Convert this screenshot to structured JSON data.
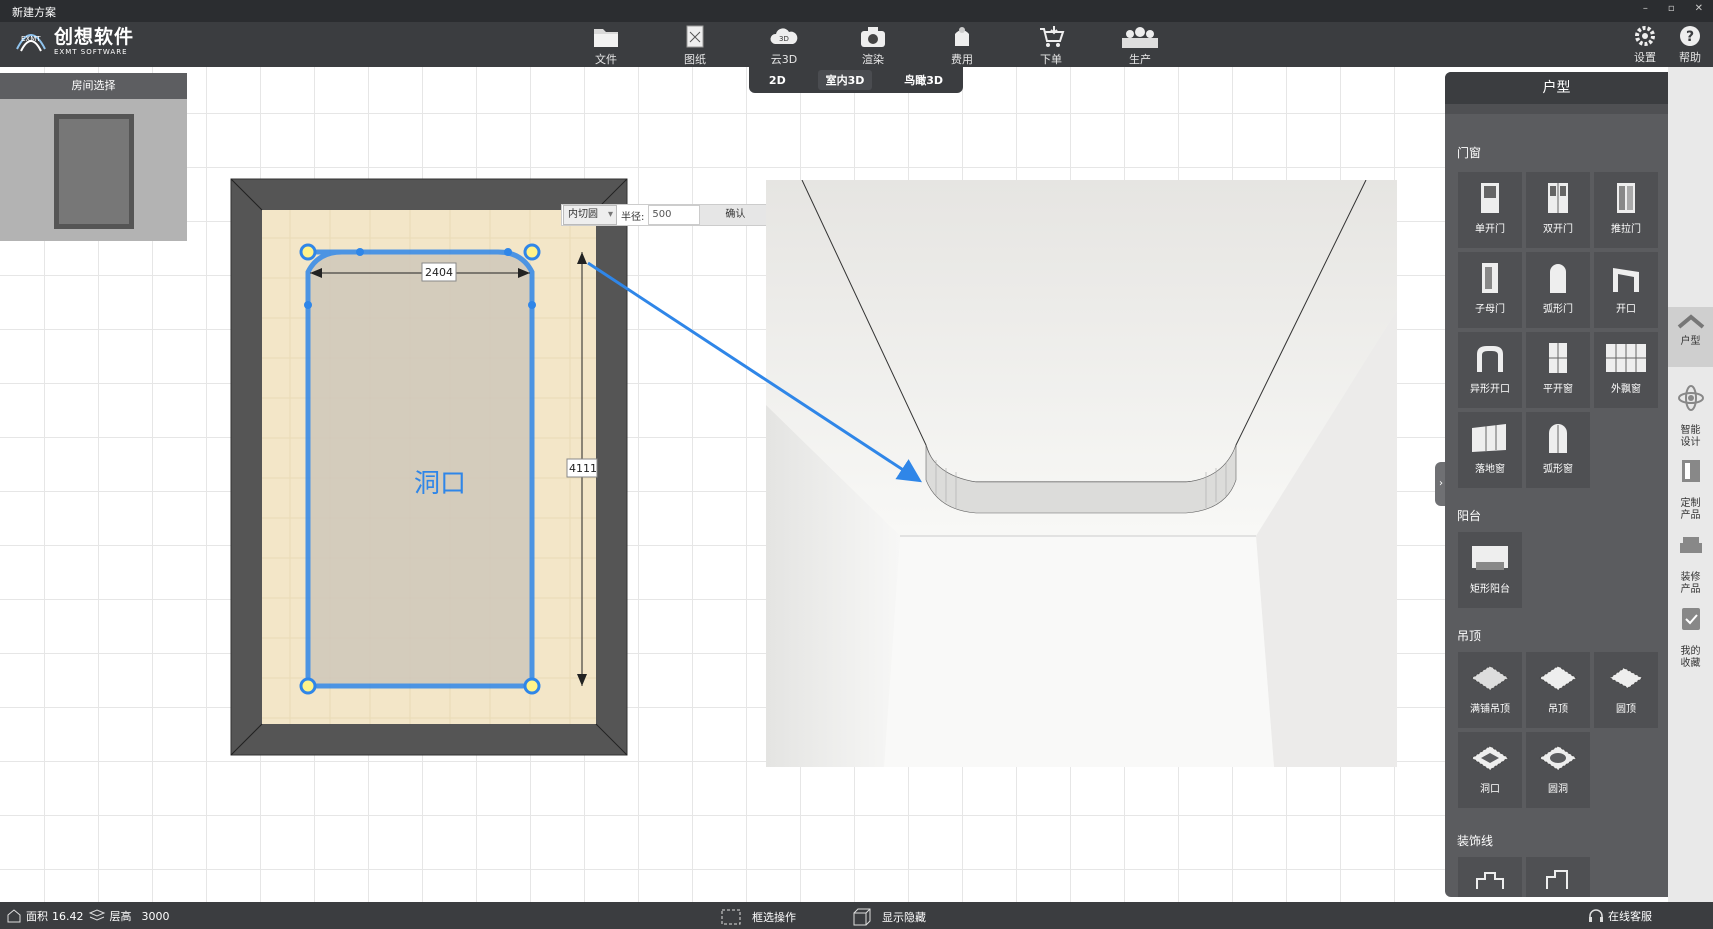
{
  "window": {
    "title": "新建方案",
    "controls": [
      "–",
      "▫",
      "✕"
    ]
  },
  "logo": {
    "name": "创想软件",
    "sub": "EXMT SOFTWARE",
    "mark": "EXMT"
  },
  "toolbar": {
    "items": [
      {
        "label": "文件",
        "icon": "folder-icon"
      },
      {
        "label": "图纸",
        "icon": "drawing-icon"
      },
      {
        "label": "云3D",
        "icon": "cloud-3d-icon"
      },
      {
        "label": "渲染",
        "icon": "camera-icon"
      },
      {
        "label": "费用",
        "icon": "money-icon"
      },
      {
        "label": "下单",
        "icon": "cart-icon"
      },
      {
        "label": "生产",
        "icon": "factory-icon"
      }
    ],
    "settings": "设置",
    "help": "帮助"
  },
  "view_tabs": [
    "2D",
    "室内3D",
    "鸟瞰3D"
  ],
  "room_select": {
    "title": "房间选择"
  },
  "canvas": {
    "width_dim": "2404",
    "height_dim": "4111",
    "opening_label": "洞口"
  },
  "tool_popup": {
    "shape": "内切圆",
    "radius_label": "半径:",
    "radius_value": "500",
    "confirm": "确认"
  },
  "panel": {
    "title": "户型",
    "sections": [
      {
        "title": "门窗",
        "items": [
          "单开门",
          "双开门",
          "推拉门",
          "子母门",
          "弧形门",
          "开口",
          "异形开口",
          "平开窗",
          "外飘窗",
          "落地窗",
          "弧形窗"
        ]
      },
      {
        "title": "阳台",
        "items": [
          "矩形阳台"
        ]
      },
      {
        "title": "吊顶",
        "items": [
          "满铺吊顶",
          "吊顶",
          "圆顶",
          "洞口",
          "圆洞"
        ]
      },
      {
        "title": "装饰线",
        "items": [
          "",
          ""
        ]
      }
    ]
  },
  "sidebar": [
    "户型",
    "智能\n设计",
    "定制\n产品",
    "装修\n产品",
    "我的\n收藏"
  ],
  "status": {
    "area_label": "面积",
    "area": "16.42",
    "height_label": "层高",
    "height": "3000",
    "select": "框选操作",
    "toggle": "显示隐藏",
    "support": "在线客服"
  },
  "colors": {
    "accent": "#2f86e8",
    "toolbar": "#3b3d40",
    "panel": "#5b5c5f",
    "wall": "#5a5a5a",
    "floor": "#f1e3c4"
  }
}
